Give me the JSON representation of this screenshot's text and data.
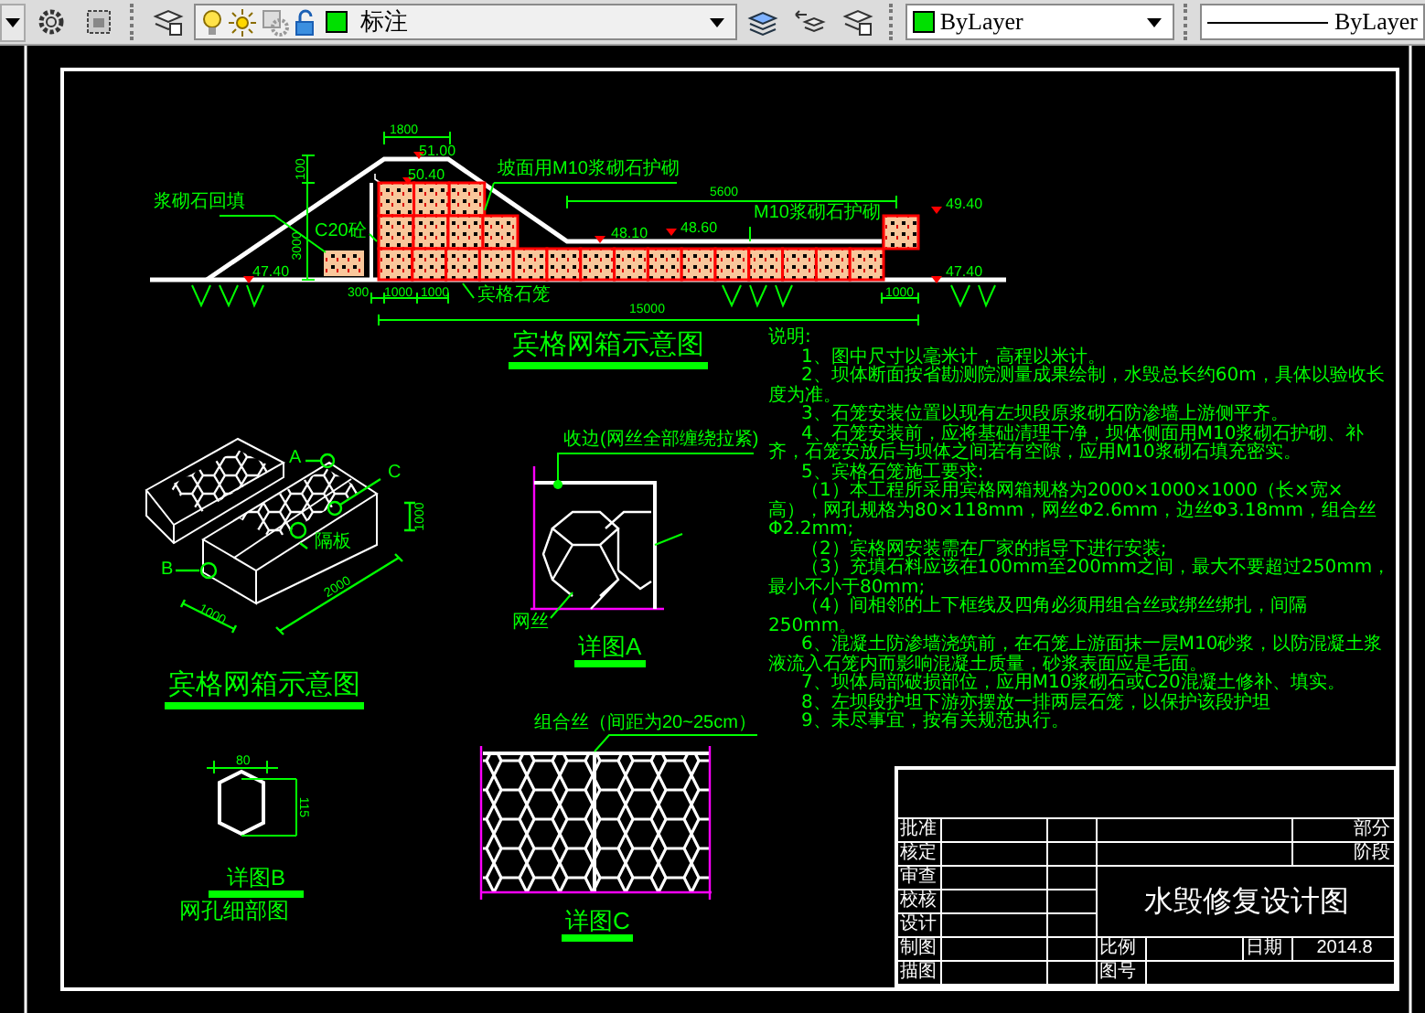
{
  "toolbar": {
    "layer": "标注",
    "color_setting": "ByLayer",
    "linetype": "ByLayer"
  },
  "section_view": {
    "title": "宾格网箱示意图",
    "annotations": [
      {
        "text": "1800",
        "kind": "dimension"
      },
      {
        "text": "51.00",
        "kind": "elevation"
      },
      {
        "text": "50.40",
        "kind": "elevation"
      },
      {
        "text": "坡面用M10浆砌石护砌",
        "kind": "callout"
      },
      {
        "text": "100",
        "kind": "dimension"
      },
      {
        "text": "3000",
        "kind": "dimension"
      },
      {
        "text": "C20砼",
        "kind": "callout"
      },
      {
        "text": "浆砌石回填",
        "kind": "callout"
      },
      {
        "text": "5600",
        "kind": "dimension"
      },
      {
        "text": "M10浆砌石护砌",
        "kind": "callout"
      },
      {
        "text": "49.40",
        "kind": "elevation"
      },
      {
        "text": "48.60",
        "kind": "elevation"
      },
      {
        "text": "48.10",
        "kind": "elevation"
      },
      {
        "text": "47.40",
        "kind": "elevation"
      },
      {
        "text": "47.40",
        "kind": "elevation"
      },
      {
        "text": "300",
        "kind": "dimension"
      },
      {
        "text": "1000",
        "kind": "dimension"
      },
      {
        "text": "1000",
        "kind": "dimension"
      },
      {
        "text": "宾格石笼",
        "kind": "callout"
      },
      {
        "text": "1000",
        "kind": "dimension"
      },
      {
        "text": "15000",
        "kind": "dimension"
      }
    ]
  },
  "box_view": {
    "title": "宾格网箱示意图",
    "annotations": [
      {
        "text": "A",
        "kind": "callout"
      },
      {
        "text": "C",
        "kind": "callout"
      },
      {
        "text": "B",
        "kind": "callout"
      },
      {
        "text": "隔板",
        "kind": "callout"
      },
      {
        "text": "1000",
        "kind": "dimension"
      },
      {
        "text": "2000",
        "kind": "dimension"
      },
      {
        "text": "1000",
        "kind": "dimension"
      }
    ]
  },
  "detail_a": {
    "title": "详图A",
    "annotations": [
      {
        "text": "收边(网丝全部缠绕拉紧)",
        "kind": "callout"
      },
      {
        "text": "网丝",
        "kind": "callout"
      }
    ]
  },
  "detail_b": {
    "title": "详图B",
    "subtitle": "网孔细部图",
    "annotations": [
      {
        "text": "80",
        "kind": "dimension"
      },
      {
        "text": "115",
        "kind": "dimension"
      }
    ]
  },
  "detail_c": {
    "title": "详图C",
    "annotations": [
      {
        "text": "组合丝（间距为20~25cm）",
        "kind": "callout"
      }
    ]
  },
  "notes": {
    "heading": "说明:",
    "items": [
      "1、图中尺寸以毫米计，高程以米计。",
      "2、坝体断面按省勘测院测量成果绘制，水毁总长约60m，具体以验收长度为准。",
      "3、石笼安装位置以现有左坝段原浆砌石防渗墙上游侧平齐。",
      "4、石笼安装前，应将基础清理干净，坝体侧面用M10浆砌石护砌、补齐，石笼安放后与坝体之间若有空隙，应用M10浆砌石填充密实。",
      "5、宾格石笼施工要求:",
      "（1）本工程所采用宾格网箱规格为2000×1000×1000（长×宽×高），网孔规格为80×118mm，网丝Φ2.6mm，边丝Φ3.18mm，组合丝Φ2.2mm;",
      "（2）宾格网安装需在厂家的指导下进行安装;",
      "（3）充填石料应该在100mm至200mm之间，最大不要超过250mm，最小不小于80mm;",
      "（4）间相邻的上下框线及四角必须用组合丝或绑丝绑扎，间隔250mm。",
      "6、混凝土防渗墙浇筑前，在石笼上游面抹一层M10砂浆，以防混凝土浆液流入石笼内而影响混凝土质量，砂浆表面应是毛面。",
      "7、坝体局部破损部位，应用M10浆砌石或C20混凝土修补、填实。",
      "8、左坝段护坦下游亦摆放一排两层石笼，以保护该段护坦",
      "9、未尽事宜，按有关规范执行。"
    ]
  },
  "title_block": {
    "row_labels": [
      "批准",
      "核定",
      "审查",
      "校核",
      "设计",
      "制图",
      "描图"
    ],
    "part_label": "部分",
    "stage_label": "阶段",
    "drawing_title": "水毁修复设计图",
    "scale_label": "比例",
    "date_label": "日期",
    "date": "2014.8",
    "number_label": "图号"
  }
}
